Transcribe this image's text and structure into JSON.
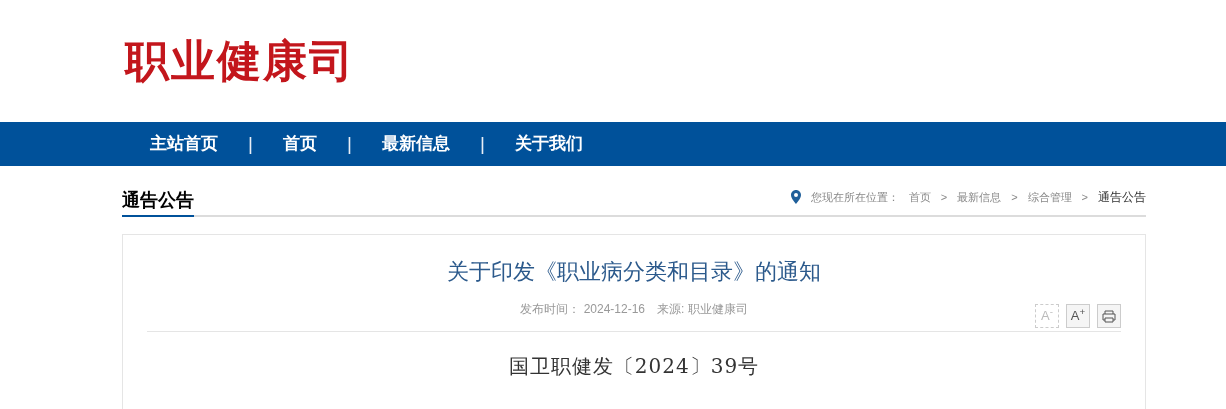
{
  "site_title": "职业健康司",
  "nav": [
    {
      "kind": "link",
      "label": "主站首页"
    },
    {
      "kind": "separator",
      "label": "|"
    },
    {
      "kind": "link",
      "label": "首页"
    },
    {
      "kind": "separator",
      "label": "|"
    },
    {
      "kind": "link",
      "label": "最新信息"
    },
    {
      "kind": "separator",
      "label": "|"
    },
    {
      "kind": "link",
      "label": "关于我们"
    }
  ],
  "section_title": "通告公告",
  "breadcrumb": {
    "label": "您现在所在位置：",
    "items": [
      {
        "label": "首页",
        "current": false
      },
      {
        "label": "最新信息",
        "current": false
      },
      {
        "label": "综合管理",
        "current": false
      },
      {
        "label": "通告公告",
        "current": true
      }
    ],
    "separator": ">"
  },
  "article": {
    "title": "关于印发《职业病分类和目录》的通知",
    "published_label": "发布时间：",
    "published": "2024-12-16",
    "source": "来源: 职业健康司",
    "tools": [
      {
        "kind": "font-smaller",
        "label": "A$^{-}$",
        "disabled": true
      },
      {
        "kind": "font-larger",
        "label": "A$^{+}$",
        "disabled": false
      },
      {
        "kind": "print",
        "disabled": false
      }
    ],
    "doc_number": "国卫职健发〔2024〕39号"
  }
}
